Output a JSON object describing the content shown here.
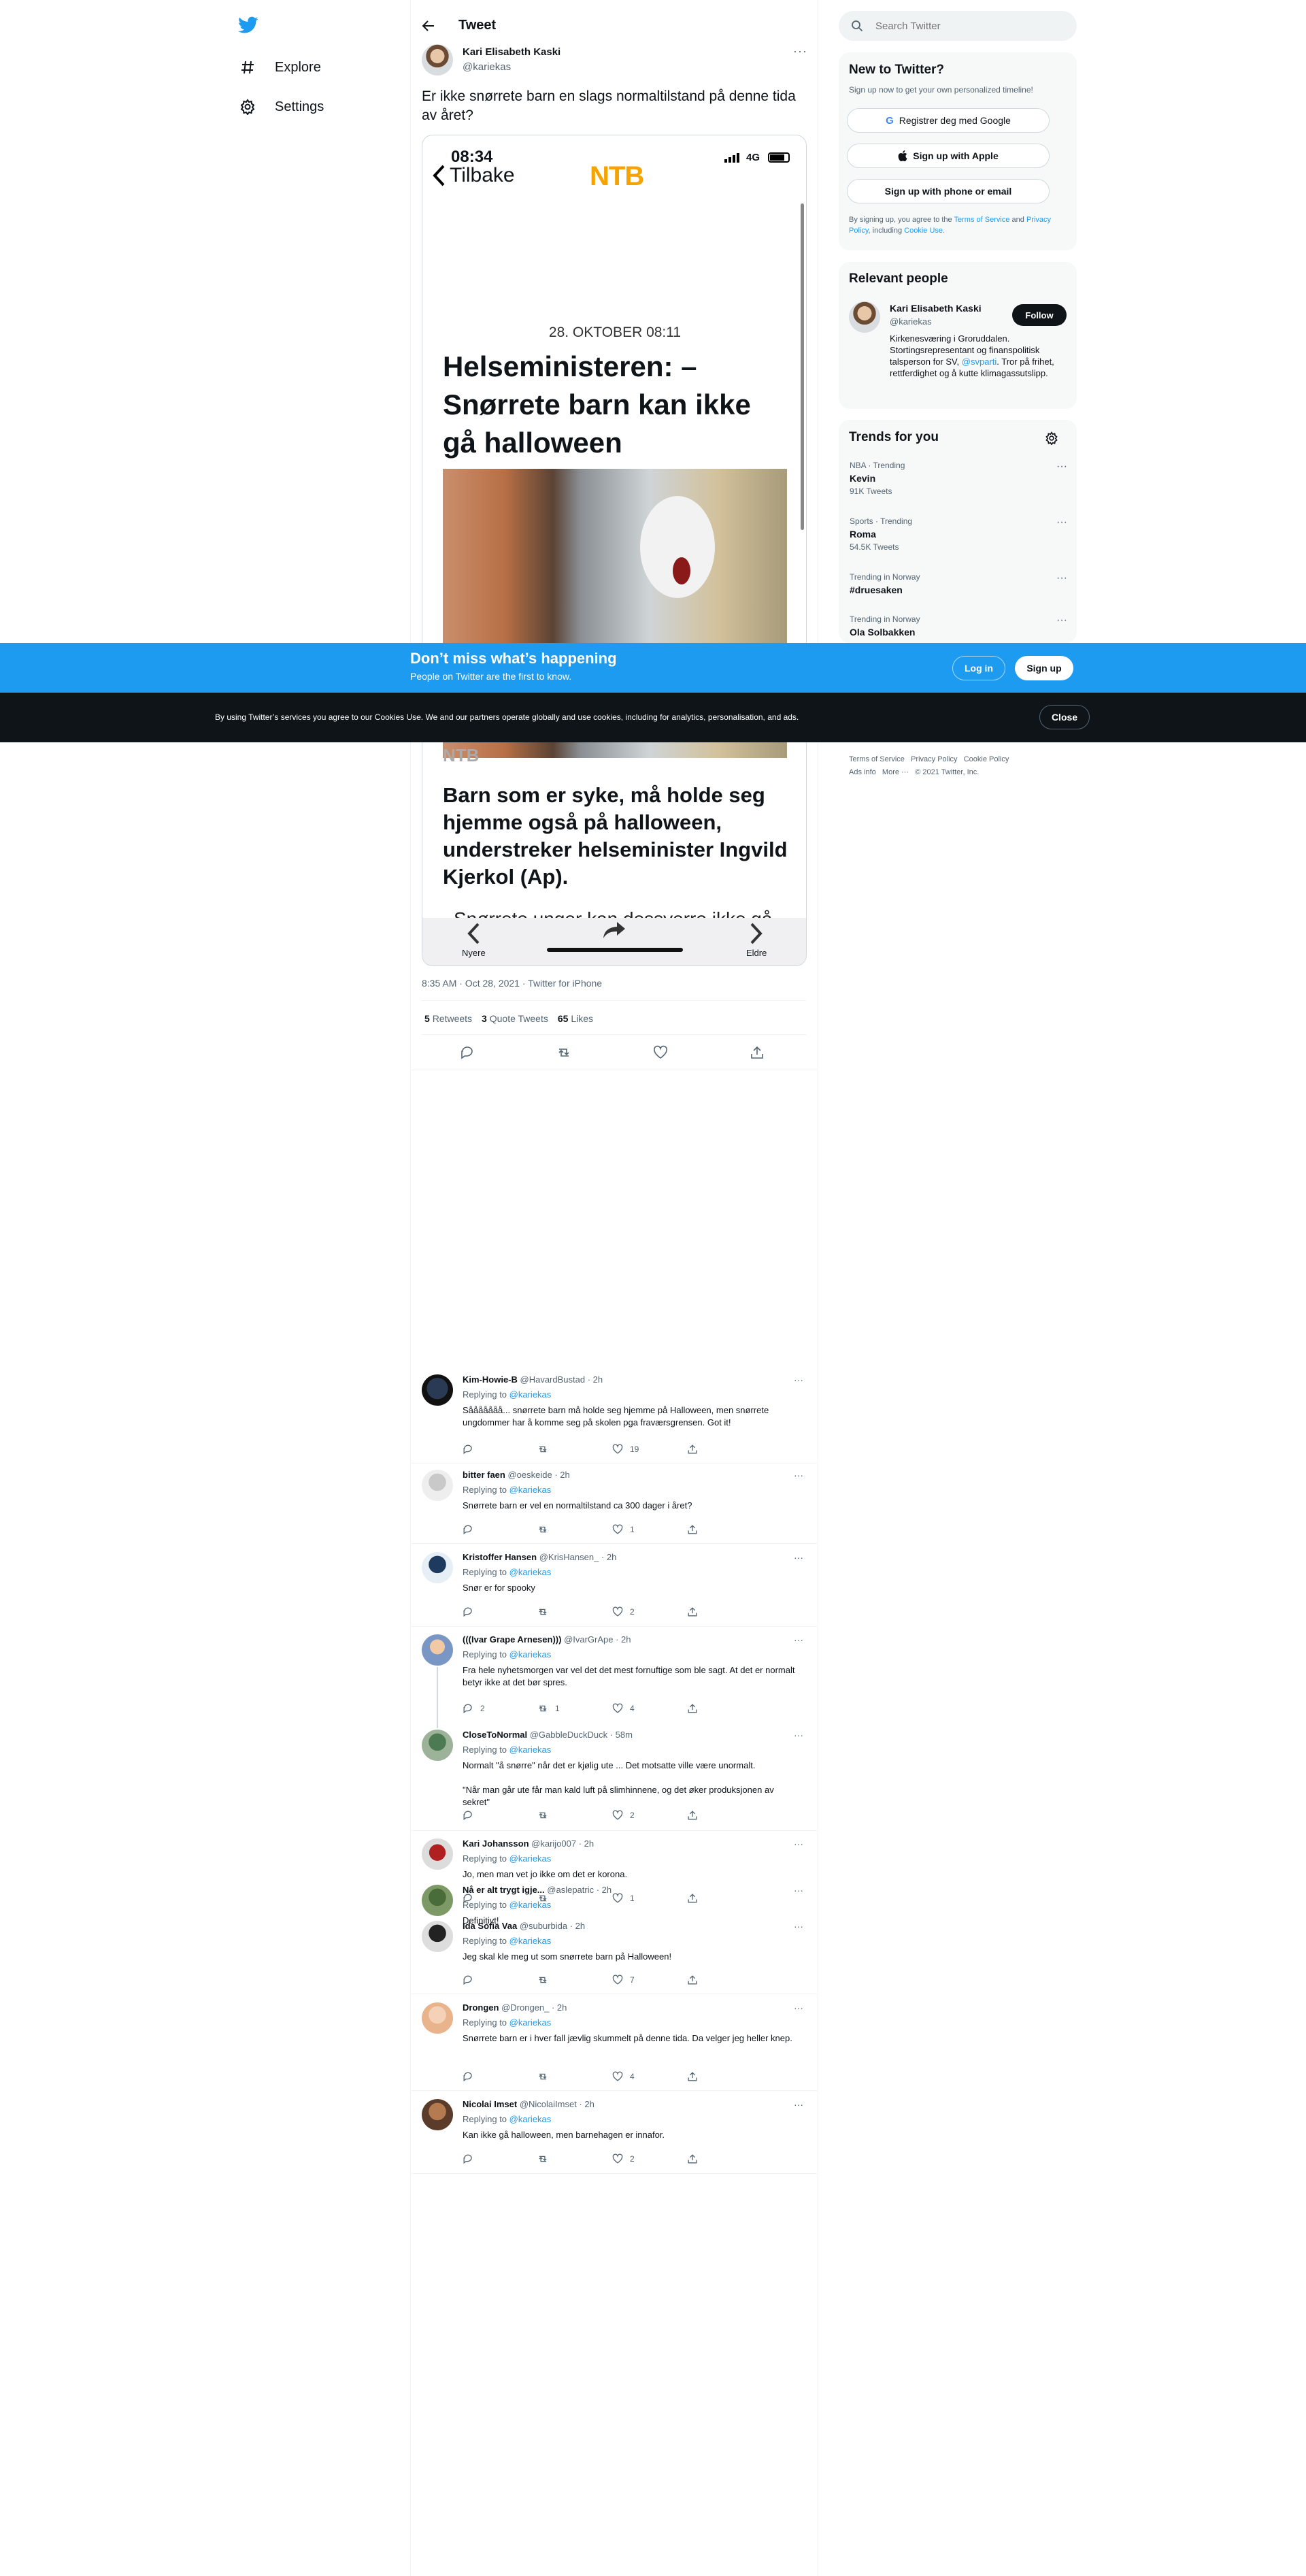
{
  "nav": {
    "explore": "Explore",
    "settings": "Settings"
  },
  "header": {
    "title": "Tweet"
  },
  "tweet": {
    "author": "Kari Elisabeth Kaski",
    "handle": "@kariekas",
    "text": "Er ikke snørrete barn en slags normaltilstand på denne tida av året?",
    "timestamp": "8:35 AM · Oct 28, 2021 · Twitter for iPhone",
    "retweets_num": "5",
    "retweets_label": "Retweets",
    "quotes_num": "3",
    "quotes_label": "Quote Tweets",
    "likes_num": "65",
    "likes_label": "Likes"
  },
  "phone": {
    "time": "08:34",
    "signal": "4G",
    "back": "Tilbake",
    "logo": "NTB",
    "date": "28. OKTOBER 08:11",
    "headline": "Helseministeren: – Snørrete barn kan ikke gå halloween",
    "source": "NTB",
    "lead": "Barn som er syke, må holde seg hjemme også på halloween, understreker helseminister Ingvild Kjerkol (Ap).",
    "partial": "Snørrete unger kan dessverre ikke gå",
    "newer": "Nyere",
    "older": "Eldre"
  },
  "search": {
    "placeholder": "Search Twitter"
  },
  "new_to_twitter": {
    "title": "New to Twitter?",
    "sub": "Sign up now to get your own personalized timeline!",
    "google": "Registrer deg med Google",
    "apple": "Sign up with Apple",
    "phone": "Sign up with phone or email",
    "terms_pre": "By signing up, you agree to the",
    "terms": "Terms of Service",
    "and": "and",
    "privacy": "Privacy Policy",
    "including": ", including",
    "cookie": "Cookie Use."
  },
  "relevant": {
    "title": "Relevant people",
    "name": "Kari Elisabeth Kaski",
    "handle": "@kariekas",
    "follow": "Follow",
    "bio_a": "Kirkenesværing i Groruddalen. Stortingsrepresentant og finanspolitisk talsperson for SV,",
    "bio_link": "@svparti",
    "bio_b": ". Tror på frihet, rettferdighet og å kutte klimagassutslipp."
  },
  "trends": {
    "title": "Trends for you",
    "items": [
      {
        "meta": "NBA · Trending",
        "name": "Kevin",
        "count": "91K Tweets"
      },
      {
        "meta": "Sports · Trending",
        "name": "Roma",
        "count": "54.5K Tweets"
      },
      {
        "meta": "Trending in Norway",
        "name": "#druesaken",
        "count": ""
      },
      {
        "meta": "Trending in Norway",
        "name": "Ola Solbakken",
        "count": ""
      }
    ]
  },
  "footer_links": {
    "terms": "Terms of Service",
    "privacy": "Privacy Policy",
    "cookie": "Cookie Policy",
    "ads": "Ads info",
    "more": "More ···",
    "copy": "© 2021 Twitter, Inc."
  },
  "banner": {
    "title": "Don’t miss what’s happening",
    "sub": "People on Twitter are the first to know.",
    "login": "Log in",
    "signup": "Sign up"
  },
  "cookie": {
    "text": "By using Twitter’s services you agree to our Cookies Use. We and our partners operate globally and use cookies, including for analytics, personalisation, and ads.",
    "close": "Close"
  },
  "replying_to": "Replying to",
  "reply_handle": "@kariekas",
  "replies": [
    {
      "name": "Kim-Howie-B",
      "handle": "@HavardBustad · 2h",
      "text": "Sååååååå... snørrete barn må holde seg hjemme på Halloween, men snørrete ungdommer har å komme seg på skolen pga fraværsgrensen. Got it!",
      "likes": "19",
      "retweets": "",
      "replies": ""
    },
    {
      "name": "bitter faen",
      "handle": "@oeskeide · 2h",
      "text": "Snørrete barn er vel en normaltilstand ca 300 dager i året?",
      "likes": "1",
      "retweets": "",
      "replies": ""
    },
    {
      "name": "Kristoffer Hansen",
      "handle": "@KrisHansen_ · 2h",
      "text": "Snør er for spooky",
      "likes": "2",
      "retweets": "",
      "replies": ""
    },
    {
      "name": "(((Ivar Grape Arnesen)))",
      "handle": "@IvarGrApe · 2h",
      "text": "Fra hele nyhetsmorgen var vel det det mest fornuftige som ble sagt. At det er normalt betyr ikke at det bør spres.",
      "likes": "4",
      "retweets": "1",
      "replies": "2"
    },
    {
      "name": "CloseToNormal",
      "handle": "@GabbleDuckDuck · 58m",
      "text": "Normalt \"å snørre\" når det er kjølig ute ... Det motsatte ville være unormalt.",
      "text2": "\"Når man går ute får man kald luft på slimhinnene, og det øker produksjonen av sekret\"",
      "likes": "2",
      "retweets": "",
      "replies": ""
    },
    {
      "name": "Kari Johansson",
      "handle": "@karijo007 · 2h",
      "text": "Jo, men man vet jo ikke om det er korona.",
      "likes": "1",
      "retweets": "",
      "replies": ""
    },
    {
      "name": "Nå er alt trygt igje...",
      "handle": "@aslepatric · 2h",
      "text": "Definitivt!",
      "likes": "",
      "retweets": "",
      "replies": ""
    },
    {
      "name": "Ida Sofia Vaa",
      "handle": "@suburbida · 2h",
      "text": "Jeg skal kle meg ut som snørrete barn på Halloween!",
      "likes": "7",
      "retweets": "",
      "replies": ""
    },
    {
      "name": "Drongen",
      "handle": "@Drongen_ · 2h",
      "text": "Snørrete barn er i hver fall jævlig skummelt på denne tida. Da velger jeg heller knep.",
      "likes": "4",
      "retweets": "",
      "replies": ""
    },
    {
      "name": "Nicolai Imset",
      "handle": "@NicolaiImset · 2h",
      "text": "Kan ikke gå halloween, men barnehagen er innafor.",
      "likes": "2",
      "retweets": "",
      "replies": ""
    }
  ],
  "colors": {
    "accent": "#1d9bf0",
    "text": "#0f1419",
    "muted": "#536471",
    "ntb": "#f5a300"
  }
}
